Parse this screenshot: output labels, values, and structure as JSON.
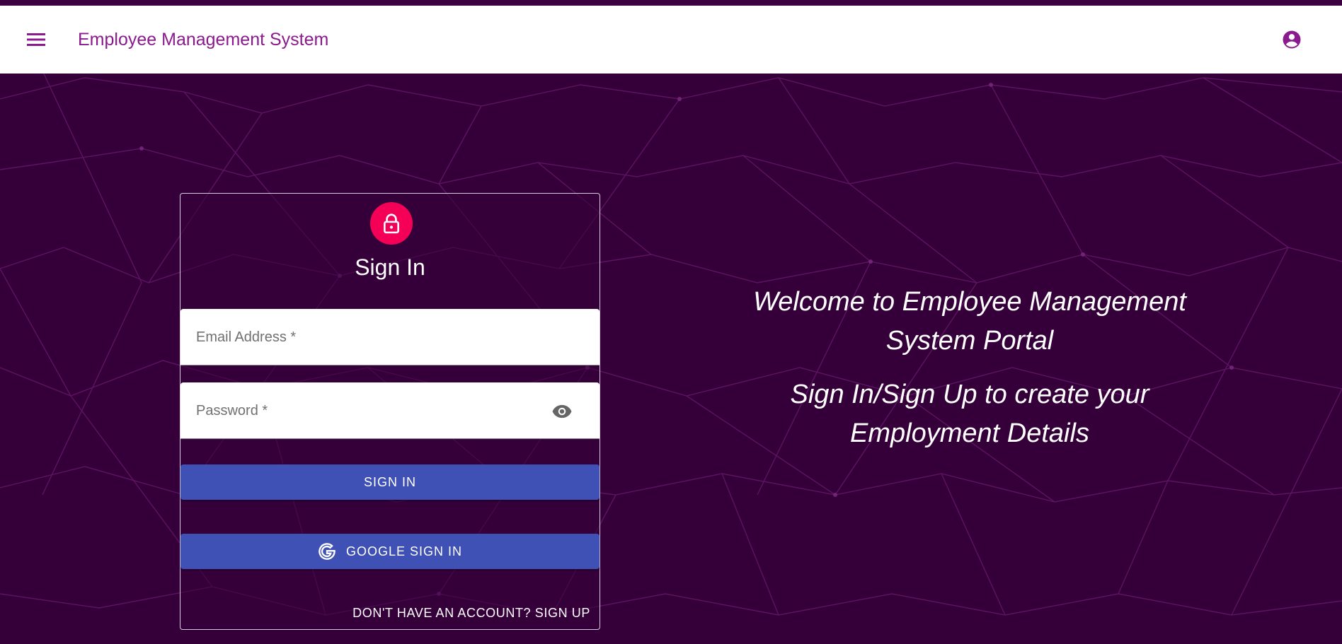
{
  "app_bar": {
    "title": "Employee Management System",
    "menu_icon": "menu-icon",
    "account_icon": "account-circle-icon"
  },
  "sign_in_card": {
    "avatar_icon": "lock-icon",
    "title": "Sign In",
    "email_field": {
      "label": "Email Address *",
      "value": ""
    },
    "password_field": {
      "label": "Password *",
      "value": "",
      "visibility_icon": "eye-icon"
    },
    "sign_in_button": "SIGN IN",
    "google_button": "GOOGLE SIGN IN",
    "google_icon": "google-icon",
    "signup_link": "DON'T HAVE AN ACCOUNT? SIGN UP"
  },
  "welcome": {
    "heading": "Welcome to Employee Management System Portal",
    "subheading": "Sign In/Sign Up to create your Employment Details"
  },
  "colors": {
    "background": "#35003a",
    "brand": "#8b1a8f",
    "accent": "#f50057",
    "button": "#3f51b5"
  }
}
